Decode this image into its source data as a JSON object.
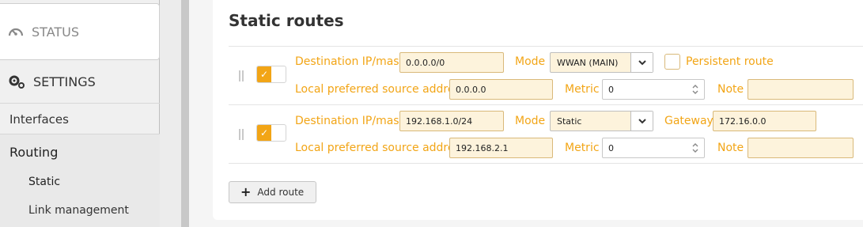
{
  "sidebar": {
    "status_label": "STATUS",
    "settings_label": "SETTINGS",
    "interfaces_label": "Interfaces",
    "routing_label": "Routing",
    "routing_items": [
      "Static",
      "Link management"
    ]
  },
  "page": {
    "title": "Static routes",
    "add_route_label": "Add route"
  },
  "routes": [
    {
      "enabled": true,
      "destination_label": "Destination IP/mask",
      "destination_value": "0.0.0.0/0",
      "mode_label": "Mode",
      "mode_value": "WWAN (MAIN)",
      "persistent_label": "Persistent route",
      "source_label": "Local preferred source address",
      "source_value": "0.0.0.0",
      "metric_label": "Metric",
      "metric_value": "0",
      "note_label": "Note",
      "note_value": ""
    },
    {
      "enabled": true,
      "destination_label": "Destination IP/mask",
      "destination_value": "192.168.1.0/24",
      "mode_label": "Mode",
      "mode_value": "Static",
      "gateway_label": "Gateway",
      "gateway_value": "172.16.0.0",
      "source_label": "Local preferred source address",
      "source_value": "192.168.2.1",
      "metric_label": "Metric",
      "metric_value": "0",
      "note_label": "Note",
      "note_value": ""
    }
  ],
  "colors": {
    "accent": "#f2a516",
    "input_bg": "#fdf3dc"
  },
  "icons": {
    "status": "gauge-icon",
    "settings": "gears-icon",
    "toggle": "check-icon",
    "select": "chevron-down-icon",
    "spinner": "spinner-arrows-icon",
    "add": "plus-icon",
    "drag": "drag-handle-icon"
  }
}
